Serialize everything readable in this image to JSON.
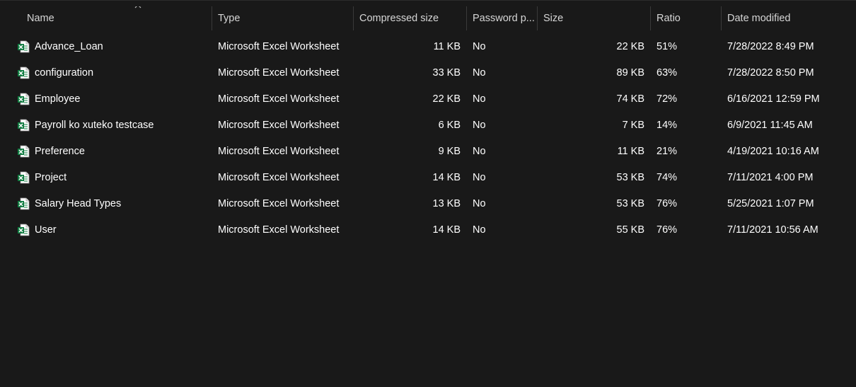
{
  "columns": {
    "name": "Name",
    "type": "Type",
    "compressed_size": "Compressed size",
    "password_protected": "Password p...",
    "size": "Size",
    "ratio": "Ratio",
    "date_modified": "Date modified"
  },
  "sort": {
    "column": "name",
    "direction": "ascending",
    "icon": "chevron-up-icon"
  },
  "files": [
    {
      "name": "Advance_Loan",
      "type": "Microsoft Excel Worksheet",
      "compressed_size": "11 KB",
      "password": "No",
      "size": "22 KB",
      "ratio": "51%",
      "date": "7/28/2022 8:49 PM",
      "icon": "excel-file-icon"
    },
    {
      "name": "configuration",
      "type": "Microsoft Excel Worksheet",
      "compressed_size": "33 KB",
      "password": "No",
      "size": "89 KB",
      "ratio": "63%",
      "date": "7/28/2022 8:50 PM",
      "icon": "excel-file-icon"
    },
    {
      "name": "Employee",
      "type": "Microsoft Excel Worksheet",
      "compressed_size": "22 KB",
      "password": "No",
      "size": "74 KB",
      "ratio": "72%",
      "date": "6/16/2021 12:59 PM",
      "icon": "excel-file-icon"
    },
    {
      "name": "Payroll ko xuteko testcase",
      "type": "Microsoft Excel Worksheet",
      "compressed_size": "6 KB",
      "password": "No",
      "size": "7 KB",
      "ratio": "14%",
      "date": "6/9/2021 11:45 AM",
      "icon": "excel-file-icon"
    },
    {
      "name": "Preference",
      "type": "Microsoft Excel Worksheet",
      "compressed_size": "9 KB",
      "password": "No",
      "size": "11 KB",
      "ratio": "21%",
      "date": "4/19/2021 10:16 AM",
      "icon": "excel-file-icon"
    },
    {
      "name": "Project",
      "type": "Microsoft Excel Worksheet",
      "compressed_size": "14 KB",
      "password": "No",
      "size": "53 KB",
      "ratio": "74%",
      "date": "7/11/2021 4:00 PM",
      "icon": "excel-file-icon"
    },
    {
      "name": "Salary Head Types",
      "type": "Microsoft Excel Worksheet",
      "compressed_size": "13 KB",
      "password": "No",
      "size": "53 KB",
      "ratio": "76%",
      "date": "5/25/2021 1:07 PM",
      "icon": "excel-file-icon"
    },
    {
      "name": "User",
      "type": "Microsoft Excel Worksheet",
      "compressed_size": "14 KB",
      "password": "No",
      "size": "55 KB",
      "ratio": "76%",
      "date": "7/11/2021 10:56 AM",
      "icon": "excel-file-icon"
    }
  ],
  "colors": {
    "background": "#191919",
    "text": "#ffffff",
    "header_text": "#d6d6d6",
    "separator": "#3a3a3a",
    "excel_green": "#107c41"
  }
}
